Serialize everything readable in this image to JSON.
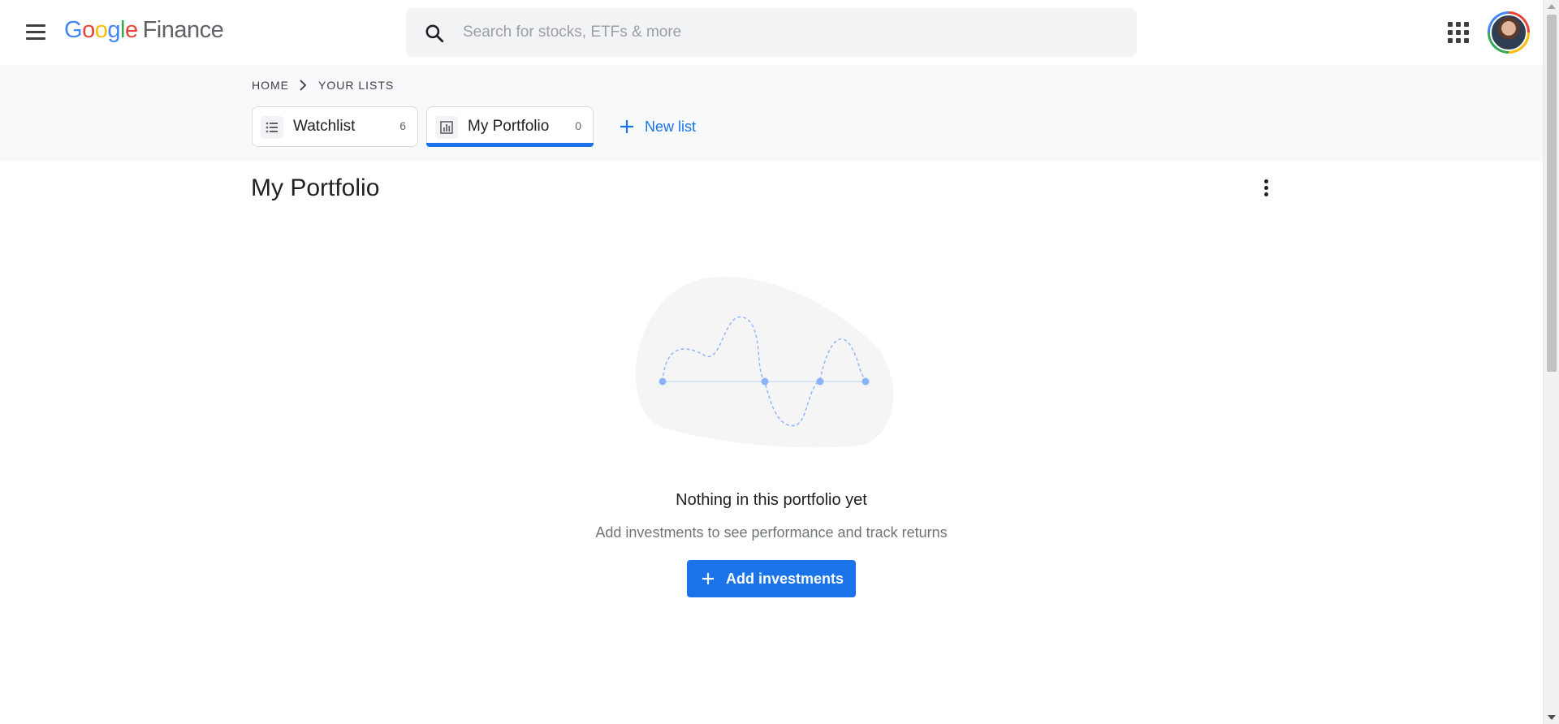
{
  "header": {
    "logo": {
      "g1": "G",
      "o1": "o",
      "o2": "o",
      "g2": "g",
      "l": "l",
      "e": "e",
      "product": "Finance"
    },
    "search": {
      "placeholder": "Search for stocks, ETFs & more"
    },
    "icons": {
      "menu": "hamburger-menu-icon",
      "search": "search-icon",
      "apps": "apps-grid-icon",
      "avatar": "user-avatar"
    }
  },
  "breadcrumb": {
    "home": "HOME",
    "current": "YOUR LISTS"
  },
  "tabs": [
    {
      "label": "Watchlist",
      "count": "6",
      "icon": "list-icon",
      "active": false
    },
    {
      "label": "My Portfolio",
      "count": "0",
      "icon": "bar-chart-icon",
      "active": true
    }
  ],
  "new_list": {
    "label": "New list"
  },
  "main": {
    "title": "My Portfolio",
    "empty_title": "Nothing in this portfolio yet",
    "empty_subtitle": "Add investments to see performance and track returns",
    "add_button": "Add investments"
  },
  "colors": {
    "accent": "#1a73e8",
    "band_bg": "#f8f9fa",
    "search_bg": "#f1f3f4",
    "google_blue": "#4285f4",
    "google_red": "#ea4335",
    "google_yellow": "#fbbc05",
    "google_green": "#34a853"
  }
}
